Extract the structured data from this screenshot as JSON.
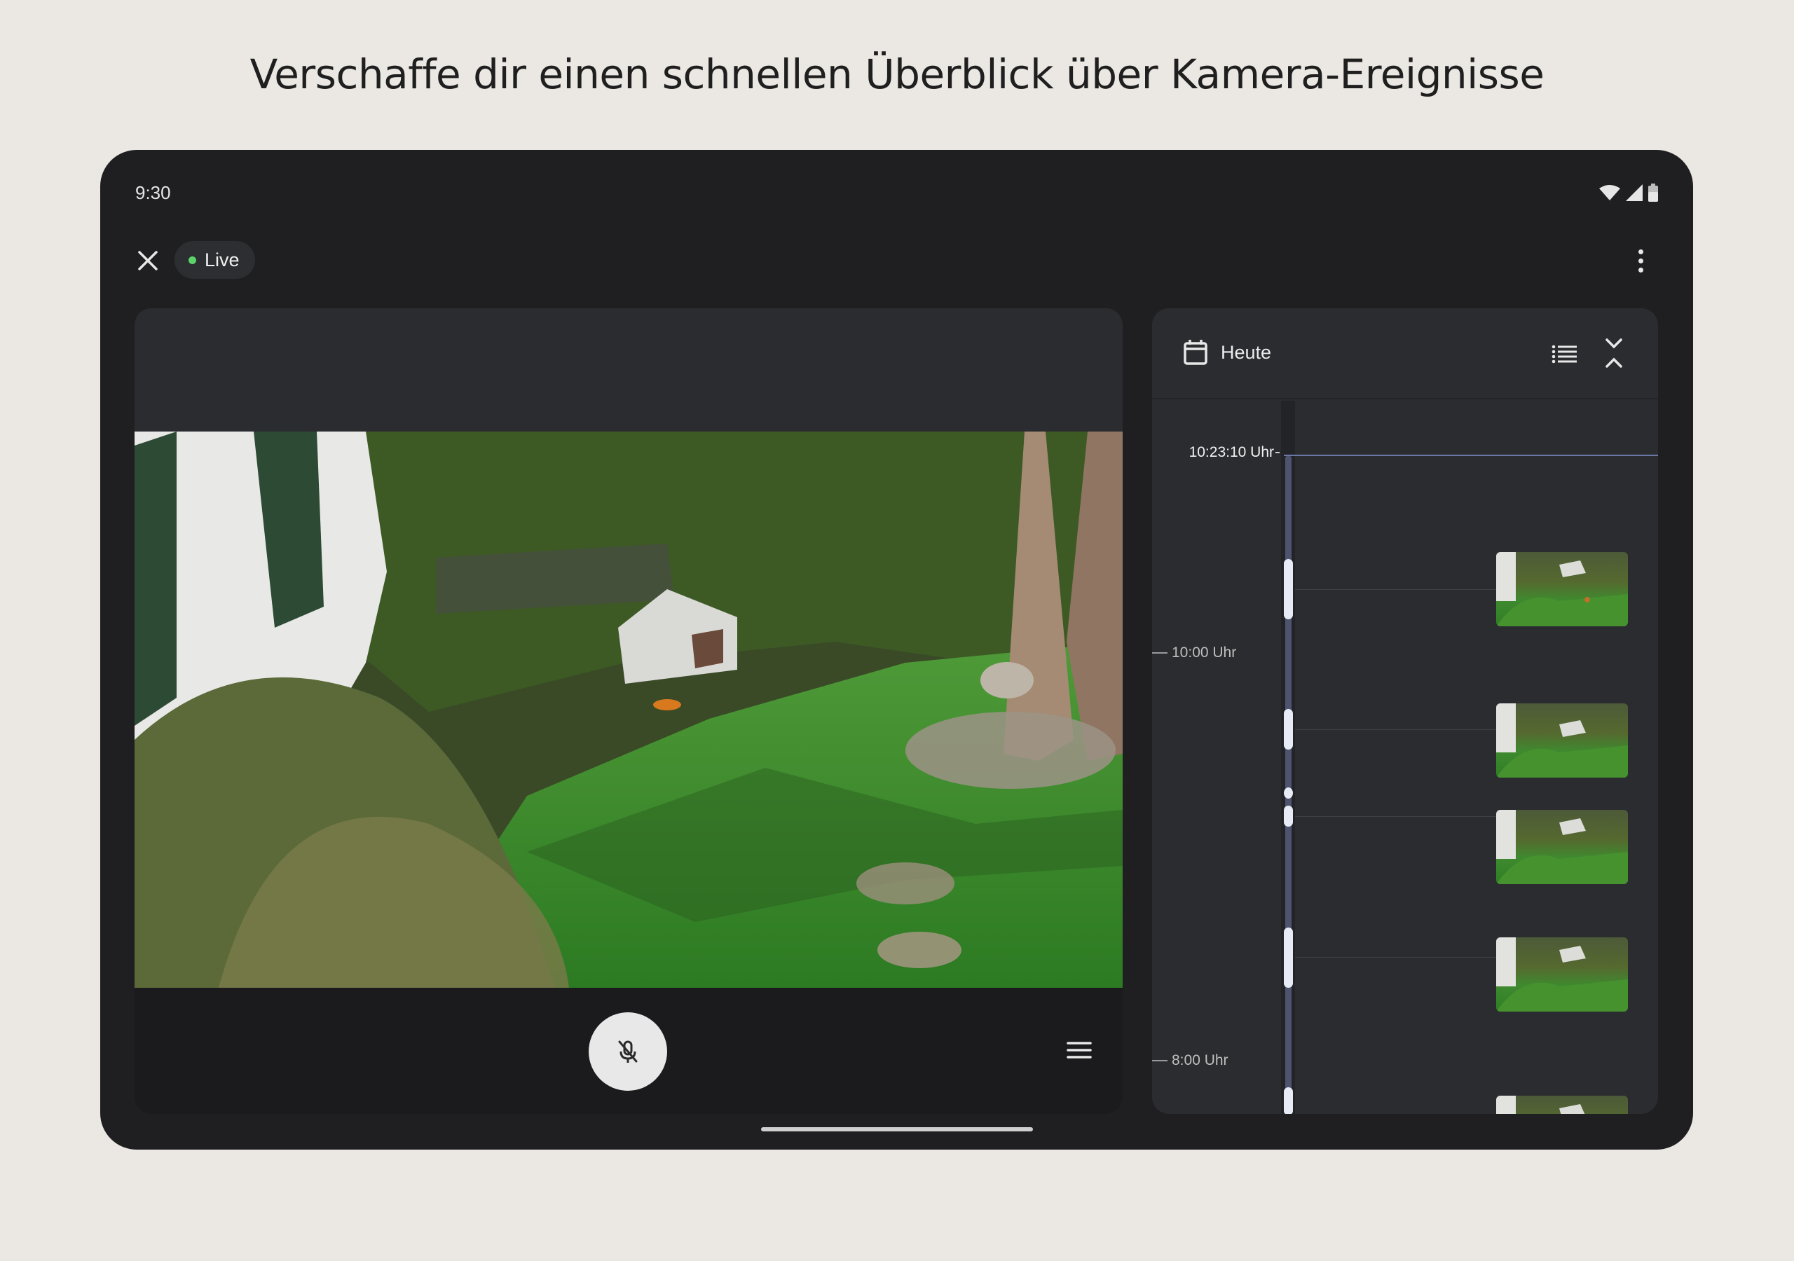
{
  "headline": "Verschaffe dir einen schnellen Überblick über Kamera-Ereignisse",
  "status_bar": {
    "time": "9:30",
    "icons": [
      "wifi-icon",
      "signal-icon",
      "battery-icon"
    ]
  },
  "top_bar": {
    "close_icon": "close-icon",
    "live_label": "Live",
    "more_icon": "more-vert-icon"
  },
  "video": {
    "mic_icon": "mic-off-icon",
    "menu_icon": "menu-icon"
  },
  "events": {
    "date_label": "Heute",
    "calendar_icon": "calendar-icon",
    "list_icon": "list-view-icon",
    "collapse_icon": "collapse-icon",
    "now_time": "10:23:10 Uhr",
    "hour_labels": [
      "10:00 Uhr",
      "8:00 Uhr"
    ]
  },
  "colors": {
    "background": "#ebe7e2",
    "device": "#1f1f21",
    "panel": "#2b2c30",
    "live_dot": "#5ad36a",
    "timeline_track": "#4e5470",
    "event_segment": "#e7ebf5"
  }
}
